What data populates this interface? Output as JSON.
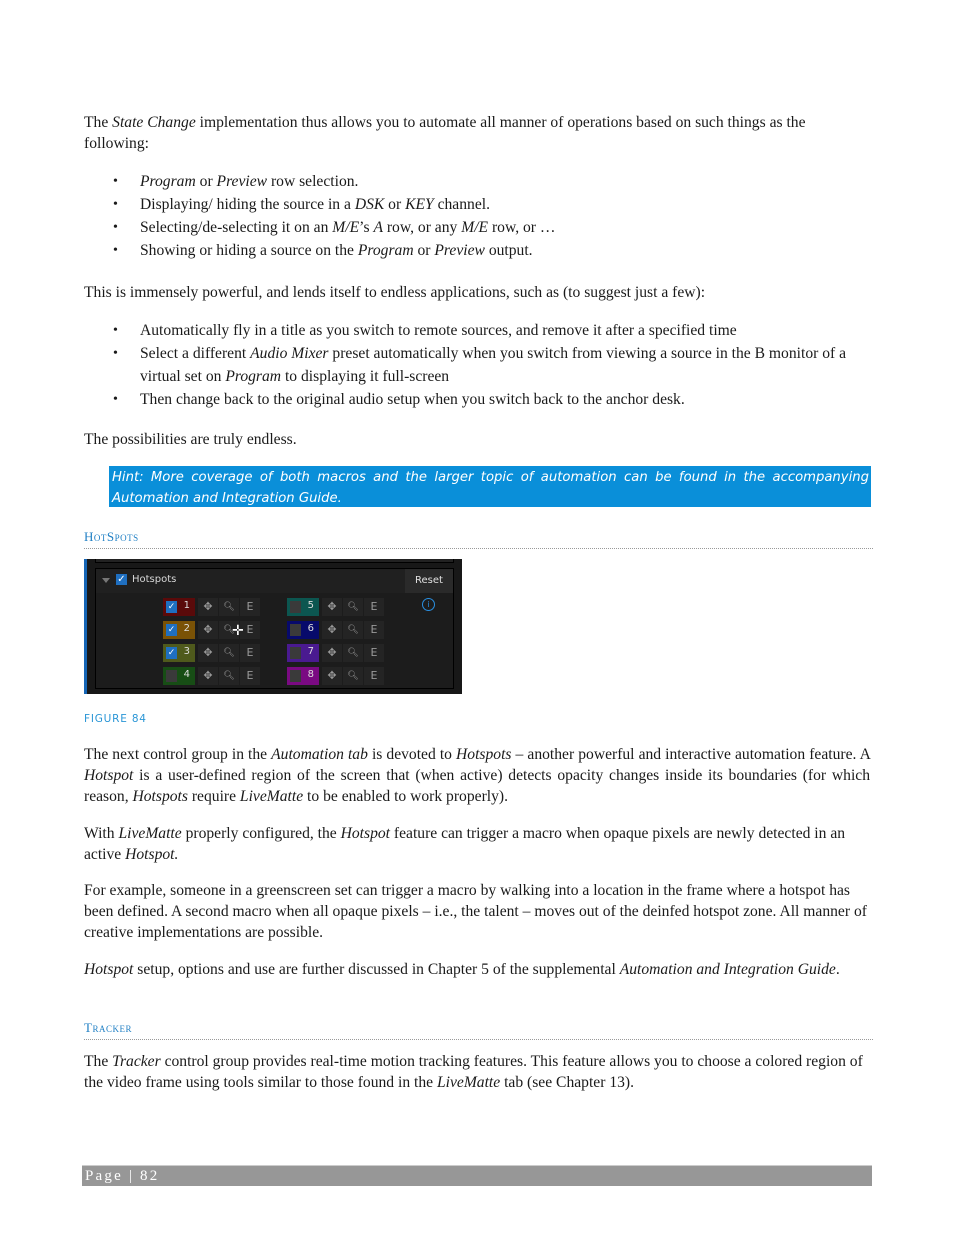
{
  "intro": {
    "p1_a": "The ",
    "p1_b": "State Change",
    "p1_c": " implementation thus allows you to automate all manner of operations based on such things as the following:"
  },
  "bullets1": [
    {
      "parts": [
        {
          "t": "Program",
          "i": true
        },
        {
          "t": " or ",
          "i": false
        },
        {
          "t": "Preview",
          "i": true
        },
        {
          "t": " row selection.",
          "i": false
        }
      ]
    },
    {
      "parts": [
        {
          "t": "Displaying/ hiding the source in a ",
          "i": false
        },
        {
          "t": "DSK",
          "i": true
        },
        {
          "t": " or ",
          "i": false
        },
        {
          "t": "KEY",
          "i": true
        },
        {
          "t": " channel.",
          "i": false
        }
      ]
    },
    {
      "parts": [
        {
          "t": "Selecting/de-selecting it on an ",
          "i": false
        },
        {
          "t": "M/E",
          "i": true
        },
        {
          "t": "’s ",
          "i": false
        },
        {
          "t": "A",
          "i": true
        },
        {
          "t": " row, or any ",
          "i": false
        },
        {
          "t": "M/E",
          "i": true
        },
        {
          "t": " row, or …",
          "i": false
        }
      ]
    },
    {
      "parts": [
        {
          "t": "Showing or hiding a source on the ",
          "i": false
        },
        {
          "t": "Program",
          "i": true
        },
        {
          "t": " or ",
          "i": false
        },
        {
          "t": "Preview",
          "i": true
        },
        {
          "t": " output.",
          "i": false
        }
      ]
    }
  ],
  "p2": "This is immensely powerful, and lends itself to endless applications, such as (to suggest just a few):",
  "bullets2": [
    {
      "parts": [
        {
          "t": "Automatically fly in a title as you switch to remote sources, and remove it after a specified time",
          "i": false
        }
      ]
    },
    {
      "parts": [
        {
          "t": "Select a different ",
          "i": false
        },
        {
          "t": "Audio Mixer",
          "i": true
        },
        {
          "t": " preset automatically when you switch from viewing a source in the B monitor of a virtual set on ",
          "i": false
        },
        {
          "t": "Program",
          "i": true
        },
        {
          "t": " to displaying it full-screen",
          "i": false
        }
      ]
    },
    {
      "parts": [
        {
          "t": "Then change back to the original audio setup when you switch back to the anchor desk.",
          "i": false
        }
      ]
    }
  ],
  "p3": "The possibilities are truly endless.",
  "hint": "Hint: More coverage of both macros and the larger topic of automation can be found in the accompanying Automation and Integration Guide.",
  "heading_hotspots": "HotSpots",
  "panel": {
    "title": "Hotspots",
    "enabled": true,
    "reset_label": "Reset",
    "edit_label": "E",
    "hotspots": [
      {
        "num": "1",
        "checked": true,
        "color": "#5a0a0a"
      },
      {
        "num": "2",
        "checked": true,
        "color": "#7a5206"
      },
      {
        "num": "3",
        "checked": true,
        "color": "#4f5a1c"
      },
      {
        "num": "4",
        "checked": false,
        "color": "#174d15"
      },
      {
        "num": "5",
        "checked": false,
        "color": "#0c5650"
      },
      {
        "num": "6",
        "checked": false,
        "color": "#070a6b"
      },
      {
        "num": "7",
        "checked": false,
        "color": "#4a1a90"
      },
      {
        "num": "8",
        "checked": false,
        "color": "#7a0a82"
      }
    ]
  },
  "figure_caption": "FIGURE 84",
  "p4": [
    {
      "t": "The next control group in the ",
      "i": false
    },
    {
      "t": "Automation tab",
      "i": true
    },
    {
      "t": " is devoted to ",
      "i": false
    },
    {
      "t": "Hotspots",
      "i": true
    },
    {
      "t": " – another powerful and interactive automation feature.  A ",
      "i": false
    },
    {
      "t": "Hotspot",
      "i": true
    },
    {
      "t": " is a user-defined region of the screen that (when active) detects opacity changes inside its boundaries (for which reason, ",
      "i": false
    },
    {
      "t": "Hotspots",
      "i": true
    },
    {
      "t": " require ",
      "i": false
    },
    {
      "t": "LiveMatte",
      "i": true
    },
    {
      "t": " to be enabled to work properly).",
      "i": false
    }
  ],
  "p5": [
    {
      "t": "With ",
      "i": false
    },
    {
      "t": "LiveMatte",
      "i": true
    },
    {
      "t": " properly configured, the ",
      "i": false
    },
    {
      "t": "Hotspot",
      "i": true
    },
    {
      "t": " feature can trigger a macro when opaque pixels are newly detected in an active ",
      "i": false
    },
    {
      "t": "Hotspot.",
      "i": true
    }
  ],
  "p6": [
    {
      "t": "For example, someone in a greenscreen set can trigger a macro by walking into a location in the frame where a hotspot has been defined. A second macro when all opaque pixels – i.e., the talent – moves out of the deinfed hotspot zone. All manner of creative implementations are possible.",
      "i": false
    }
  ],
  "p7": [
    {
      "t": " ",
      "i": false
    },
    {
      "t": "Hotspot",
      "i": true
    },
    {
      "t": " setup, options and use are further discussed in Chapter 5 of the supplemental ",
      "i": false
    },
    {
      "t": "Automation and Integration Guide",
      "i": true
    },
    {
      "t": ".",
      "i": false
    }
  ],
  "heading_tracker": "Tracker",
  "p8": [
    {
      "t": "The ",
      "i": false
    },
    {
      "t": "Tracker",
      "i": true
    },
    {
      "t": " control group provides real-time motion tracking features.  This feature allows you to choose a colored region of the video frame using tools similar to those found in the ",
      "i": false
    },
    {
      "t": "LiveMatte",
      "i": true
    },
    {
      "t": " tab (see Chapter 13).",
      "i": false
    }
  ],
  "footer": "Page | 82"
}
